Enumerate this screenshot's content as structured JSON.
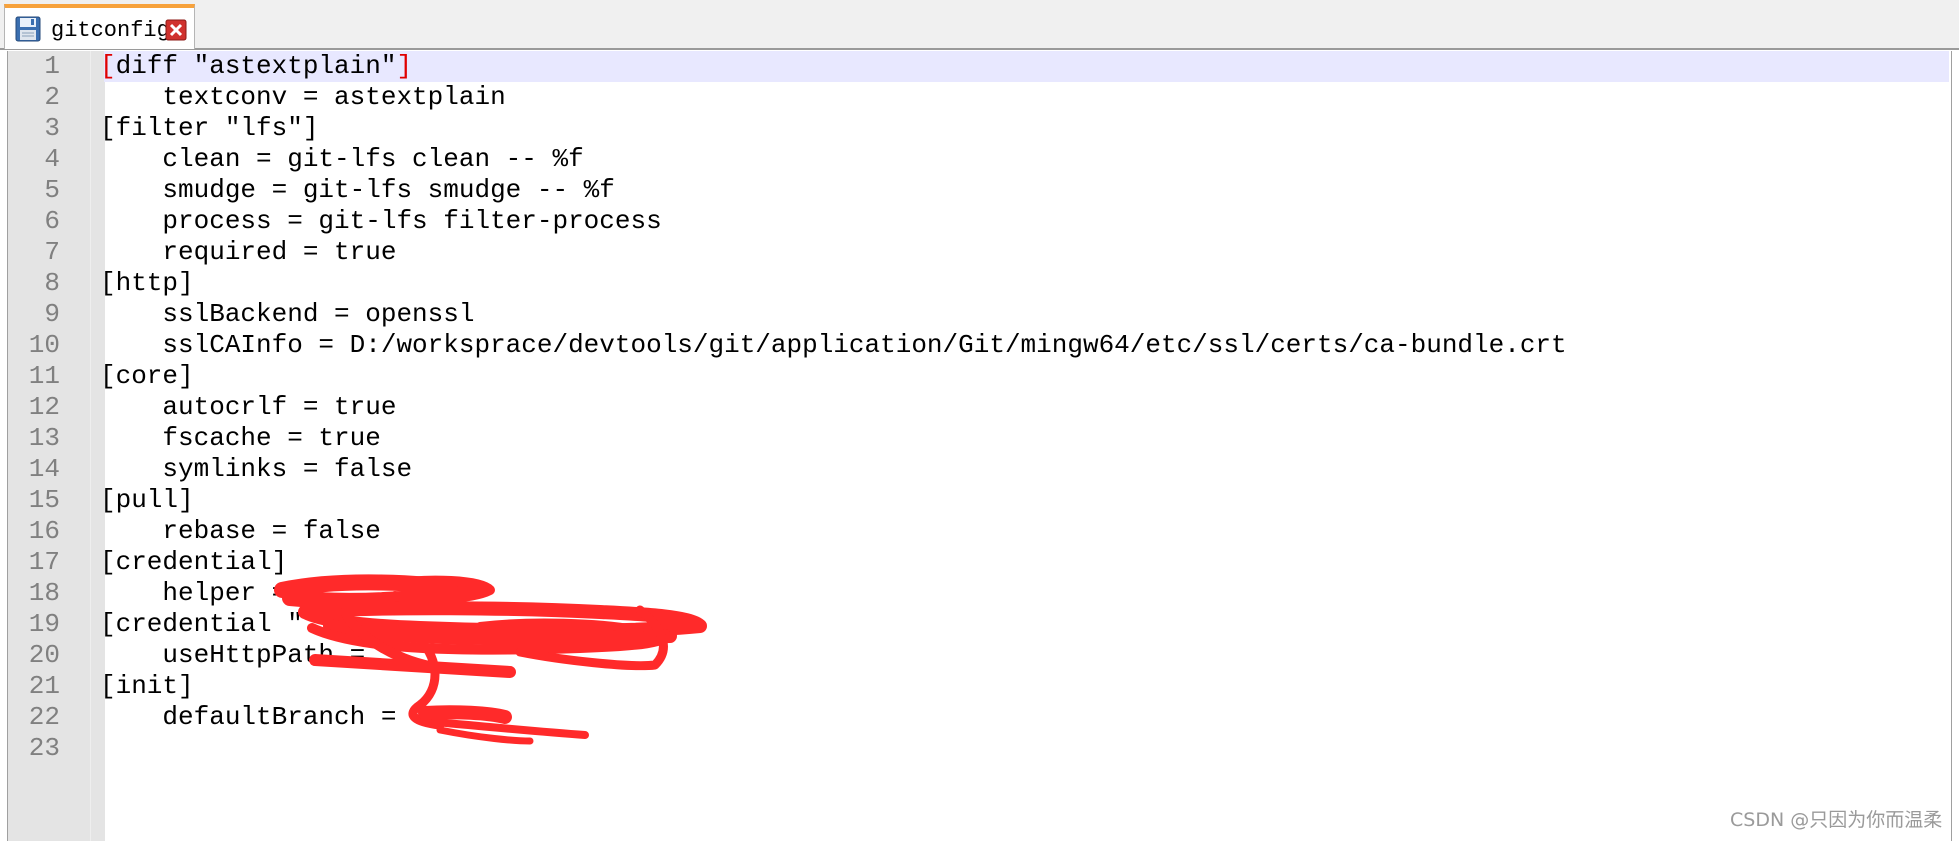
{
  "tab": {
    "label": "gitconfig",
    "save_icon": "floppy-disk-icon",
    "close_icon": "close-icon",
    "accent_color": "#f7a23c",
    "close_color": "#d0312d"
  },
  "editor": {
    "current_line": 1,
    "current_line_color": "#e8e8ff",
    "bracket_highlight_color": "#e00000",
    "lines": [
      {
        "num": "1",
        "text": "[diff \"astextplain\"]"
      },
      {
        "num": "2",
        "text": "    textconv = astextplain"
      },
      {
        "num": "3",
        "text": "[filter \"lfs\"]"
      },
      {
        "num": "4",
        "text": "    clean = git-lfs clean -- %f"
      },
      {
        "num": "5",
        "text": "    smudge = git-lfs smudge -- %f"
      },
      {
        "num": "6",
        "text": "    process = git-lfs filter-process"
      },
      {
        "num": "7",
        "text": "    required = true"
      },
      {
        "num": "8",
        "text": "[http]"
      },
      {
        "num": "9",
        "text": "    sslBackend = openssl"
      },
      {
        "num": "10",
        "text": "    sslCAInfo = D:/worksprace/devtools/git/application/Git/mingw64/etc/ssl/certs/ca-bundle.crt"
      },
      {
        "num": "11",
        "text": "[core]"
      },
      {
        "num": "12",
        "text": "    autocrlf = true"
      },
      {
        "num": "13",
        "text": "    fscache = true"
      },
      {
        "num": "14",
        "text": "    symlinks = false"
      },
      {
        "num": "15",
        "text": "[pull]"
      },
      {
        "num": "16",
        "text": "    rebase = false"
      },
      {
        "num": "17",
        "text": "[credential]"
      },
      {
        "num": "18",
        "text": "    helper = "
      },
      {
        "num": "19",
        "text": "[credential \""
      },
      {
        "num": "20",
        "text": "    useHttpPath = "
      },
      {
        "num": "21",
        "text": "[init]"
      },
      {
        "num": "22",
        "text": "    defaultBranch = "
      },
      {
        "num": "23",
        "text": ""
      }
    ]
  },
  "redaction": {
    "color": "#ff2a2a"
  },
  "watermark": {
    "text": "CSDN @只因为你而温柔"
  }
}
